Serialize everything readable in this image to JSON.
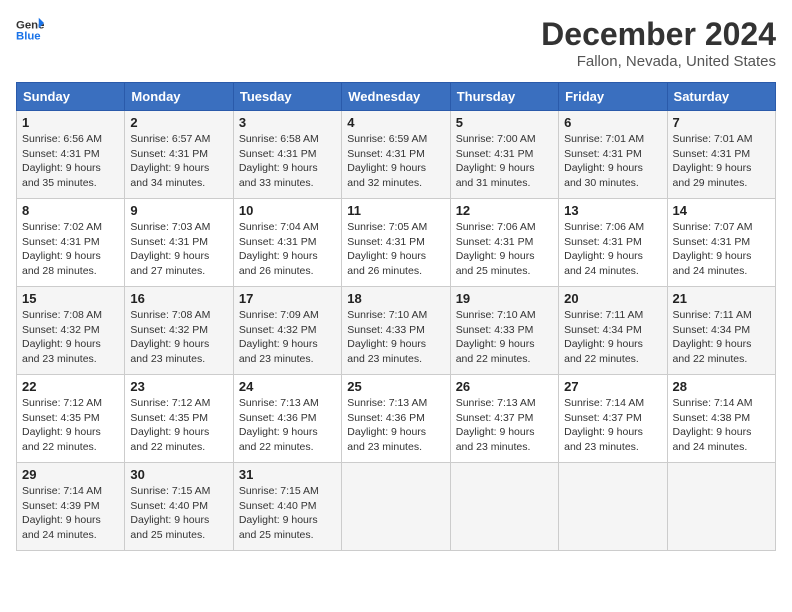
{
  "logo": {
    "line1": "General",
    "line2": "Blue"
  },
  "title": "December 2024",
  "subtitle": "Fallon, Nevada, United States",
  "days_of_week": [
    "Sunday",
    "Monday",
    "Tuesday",
    "Wednesday",
    "Thursday",
    "Friday",
    "Saturday"
  ],
  "weeks": [
    [
      {
        "day": "1",
        "info": "Sunrise: 6:56 AM\nSunset: 4:31 PM\nDaylight: 9 hours\nand 35 minutes."
      },
      {
        "day": "2",
        "info": "Sunrise: 6:57 AM\nSunset: 4:31 PM\nDaylight: 9 hours\nand 34 minutes."
      },
      {
        "day": "3",
        "info": "Sunrise: 6:58 AM\nSunset: 4:31 PM\nDaylight: 9 hours\nand 33 minutes."
      },
      {
        "day": "4",
        "info": "Sunrise: 6:59 AM\nSunset: 4:31 PM\nDaylight: 9 hours\nand 32 minutes."
      },
      {
        "day": "5",
        "info": "Sunrise: 7:00 AM\nSunset: 4:31 PM\nDaylight: 9 hours\nand 31 minutes."
      },
      {
        "day": "6",
        "info": "Sunrise: 7:01 AM\nSunset: 4:31 PM\nDaylight: 9 hours\nand 30 minutes."
      },
      {
        "day": "7",
        "info": "Sunrise: 7:01 AM\nSunset: 4:31 PM\nDaylight: 9 hours\nand 29 minutes."
      }
    ],
    [
      {
        "day": "8",
        "info": "Sunrise: 7:02 AM\nSunset: 4:31 PM\nDaylight: 9 hours\nand 28 minutes."
      },
      {
        "day": "9",
        "info": "Sunrise: 7:03 AM\nSunset: 4:31 PM\nDaylight: 9 hours\nand 27 minutes."
      },
      {
        "day": "10",
        "info": "Sunrise: 7:04 AM\nSunset: 4:31 PM\nDaylight: 9 hours\nand 26 minutes."
      },
      {
        "day": "11",
        "info": "Sunrise: 7:05 AM\nSunset: 4:31 PM\nDaylight: 9 hours\nand 26 minutes."
      },
      {
        "day": "12",
        "info": "Sunrise: 7:06 AM\nSunset: 4:31 PM\nDaylight: 9 hours\nand 25 minutes."
      },
      {
        "day": "13",
        "info": "Sunrise: 7:06 AM\nSunset: 4:31 PM\nDaylight: 9 hours\nand 24 minutes."
      },
      {
        "day": "14",
        "info": "Sunrise: 7:07 AM\nSunset: 4:31 PM\nDaylight: 9 hours\nand 24 minutes."
      }
    ],
    [
      {
        "day": "15",
        "info": "Sunrise: 7:08 AM\nSunset: 4:32 PM\nDaylight: 9 hours\nand 23 minutes."
      },
      {
        "day": "16",
        "info": "Sunrise: 7:08 AM\nSunset: 4:32 PM\nDaylight: 9 hours\nand 23 minutes."
      },
      {
        "day": "17",
        "info": "Sunrise: 7:09 AM\nSunset: 4:32 PM\nDaylight: 9 hours\nand 23 minutes."
      },
      {
        "day": "18",
        "info": "Sunrise: 7:10 AM\nSunset: 4:33 PM\nDaylight: 9 hours\nand 23 minutes."
      },
      {
        "day": "19",
        "info": "Sunrise: 7:10 AM\nSunset: 4:33 PM\nDaylight: 9 hours\nand 22 minutes."
      },
      {
        "day": "20",
        "info": "Sunrise: 7:11 AM\nSunset: 4:34 PM\nDaylight: 9 hours\nand 22 minutes."
      },
      {
        "day": "21",
        "info": "Sunrise: 7:11 AM\nSunset: 4:34 PM\nDaylight: 9 hours\nand 22 minutes."
      }
    ],
    [
      {
        "day": "22",
        "info": "Sunrise: 7:12 AM\nSunset: 4:35 PM\nDaylight: 9 hours\nand 22 minutes."
      },
      {
        "day": "23",
        "info": "Sunrise: 7:12 AM\nSunset: 4:35 PM\nDaylight: 9 hours\nand 22 minutes."
      },
      {
        "day": "24",
        "info": "Sunrise: 7:13 AM\nSunset: 4:36 PM\nDaylight: 9 hours\nand 22 minutes."
      },
      {
        "day": "25",
        "info": "Sunrise: 7:13 AM\nSunset: 4:36 PM\nDaylight: 9 hours\nand 23 minutes."
      },
      {
        "day": "26",
        "info": "Sunrise: 7:13 AM\nSunset: 4:37 PM\nDaylight: 9 hours\nand 23 minutes."
      },
      {
        "day": "27",
        "info": "Sunrise: 7:14 AM\nSunset: 4:37 PM\nDaylight: 9 hours\nand 23 minutes."
      },
      {
        "day": "28",
        "info": "Sunrise: 7:14 AM\nSunset: 4:38 PM\nDaylight: 9 hours\nand 24 minutes."
      }
    ],
    [
      {
        "day": "29",
        "info": "Sunrise: 7:14 AM\nSunset: 4:39 PM\nDaylight: 9 hours\nand 24 minutes."
      },
      {
        "day": "30",
        "info": "Sunrise: 7:15 AM\nSunset: 4:40 PM\nDaylight: 9 hours\nand 25 minutes."
      },
      {
        "day": "31",
        "info": "Sunrise: 7:15 AM\nSunset: 4:40 PM\nDaylight: 9 hours\nand 25 minutes."
      },
      null,
      null,
      null,
      null
    ]
  ]
}
